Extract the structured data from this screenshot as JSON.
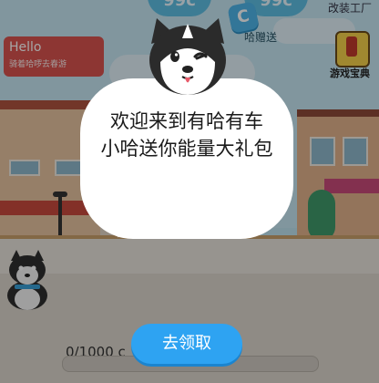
{
  "hud": {
    "energy_left": "99c",
    "energy_right": "99c",
    "coin_letter": "C",
    "gift_label": "哈赠送",
    "top_right_label": "改装工厂",
    "guide_label": "游戏宝典",
    "progress_text": "0/1000 c",
    "progress_fraction": 0.0
  },
  "hello_card": {
    "title": "Hello",
    "subtitle": "骑着哈啰去春游"
  },
  "dialog": {
    "line1": "欢迎来到有哈有车",
    "line2": "小哈送你能量大礼包",
    "claim_button": "去领取"
  },
  "colors": {
    "accent": "#2ea3f2",
    "energy": "#5fbfe3",
    "hello_red": "#d9534f"
  }
}
